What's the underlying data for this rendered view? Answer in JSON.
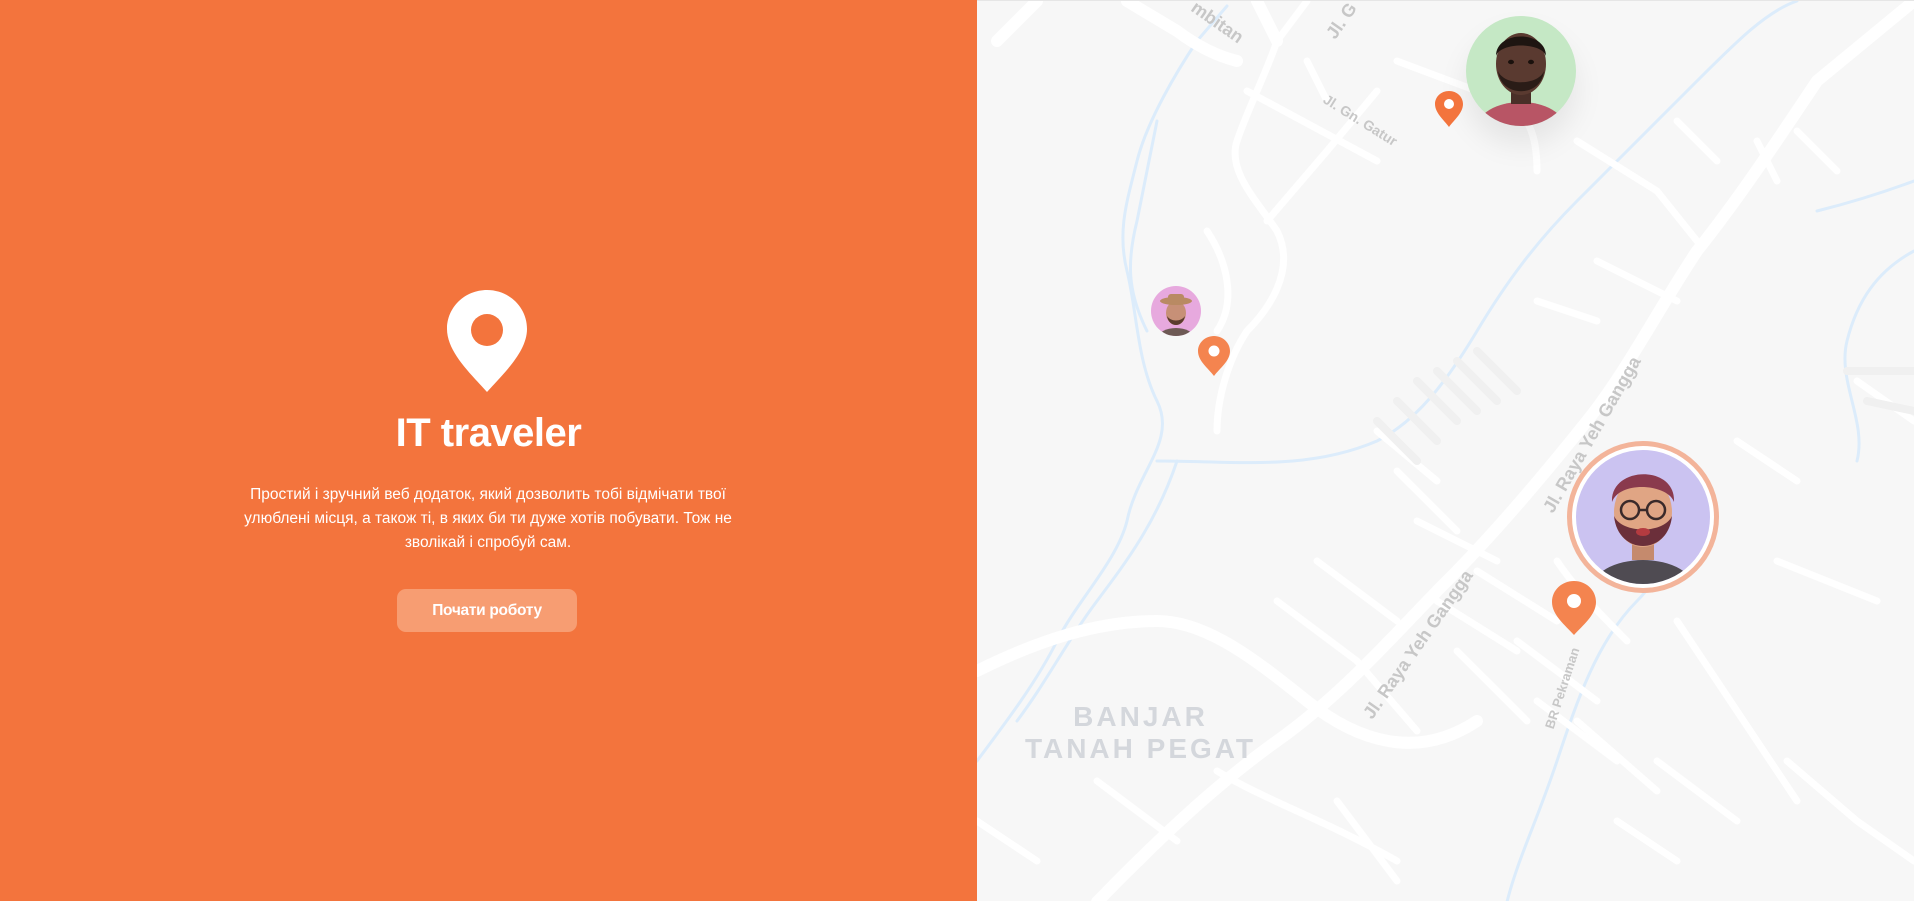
{
  "hero": {
    "logo_icon": "map-pin-icon",
    "title": "IT traveler",
    "description": "Простий і зручний веб додаток, який дозволить тобі відмічати твої улюблені місця, а також ті, в яких би ти дуже хотів побувати. Тож не зволікай і спробуй сам.",
    "cta_label": "Почати роботу"
  },
  "map": {
    "road_labels": [
      "Jl. Raya Yeh Gangga",
      "Jl. Raya Yeh Gangga",
      "Jl. Gn. Gatur",
      "BR Pekraman",
      "mbitan",
      "Jl. G"
    ],
    "area_label_line1": "BANJAR",
    "area_label_line2": "TANAH PEGAT",
    "avatars": [
      "avatar-green",
      "avatar-pink-hat",
      "avatar-purple-glasses"
    ],
    "marker_icon": "map-marker-icon"
  },
  "colors": {
    "accent": "#f3743d",
    "button": "#f79d72",
    "map_bg": "#f7f7f7"
  }
}
